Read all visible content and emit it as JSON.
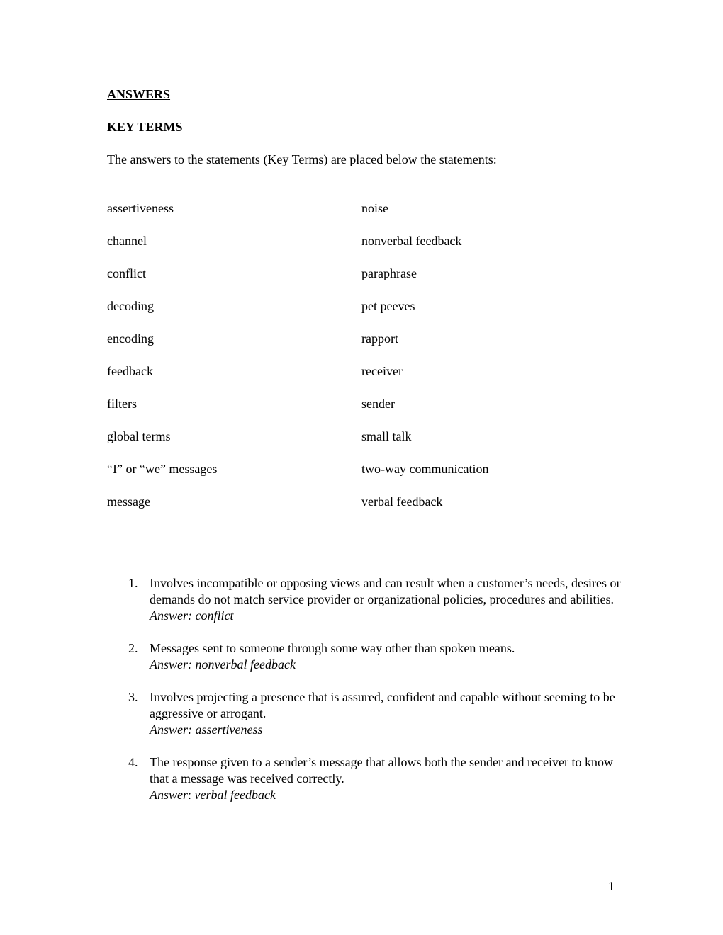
{
  "document": {
    "heading": "ANSWERS",
    "section_title": "KEY TERMS",
    "intro": "The answers to the statements (Key Terms) are placed below the statements:",
    "key_terms": {
      "left": [
        "assertiveness",
        "channel",
        "conflict",
        "decoding",
        "encoding",
        "feedback",
        "filters",
        "global terms",
        "“I” or “we” messages",
        "message"
      ],
      "right": [
        "noise",
        "nonverbal feedback",
        "paraphrase",
        "pet peeves",
        "rapport",
        "receiver",
        "sender",
        "small talk",
        "two-way communication",
        "verbal feedback"
      ]
    },
    "questions": [
      {
        "number": "1.",
        "text": "Involves incompatible or opposing views and can result when a customer’s needs, desires or demands do not match service provider or organizational policies, procedures and abilities.",
        "answer_label": "Answer",
        "answer_sep": ": ",
        "answer": "conflict"
      },
      {
        "number": "2.",
        "text": "Messages sent to someone through some way other than spoken means.",
        "answer_label": "Answer",
        "answer_sep": ": ",
        "answer": "nonverbal feedback"
      },
      {
        "number": "3.",
        "text": "Involves projecting a presence that is assured, confident and capable without seeming to be aggressive or arrogant.",
        "answer_label": "Answer",
        "answer_sep": ": ",
        "answer": "assertiveness"
      },
      {
        "number": "4.",
        "text": "The response given to a sender’s message that allows both the sender and receiver to know that a message was received correctly.",
        "answer_label": "Answer",
        "answer_sep": ": ",
        "answer": "verbal feedback"
      }
    ],
    "page_number": "1"
  }
}
